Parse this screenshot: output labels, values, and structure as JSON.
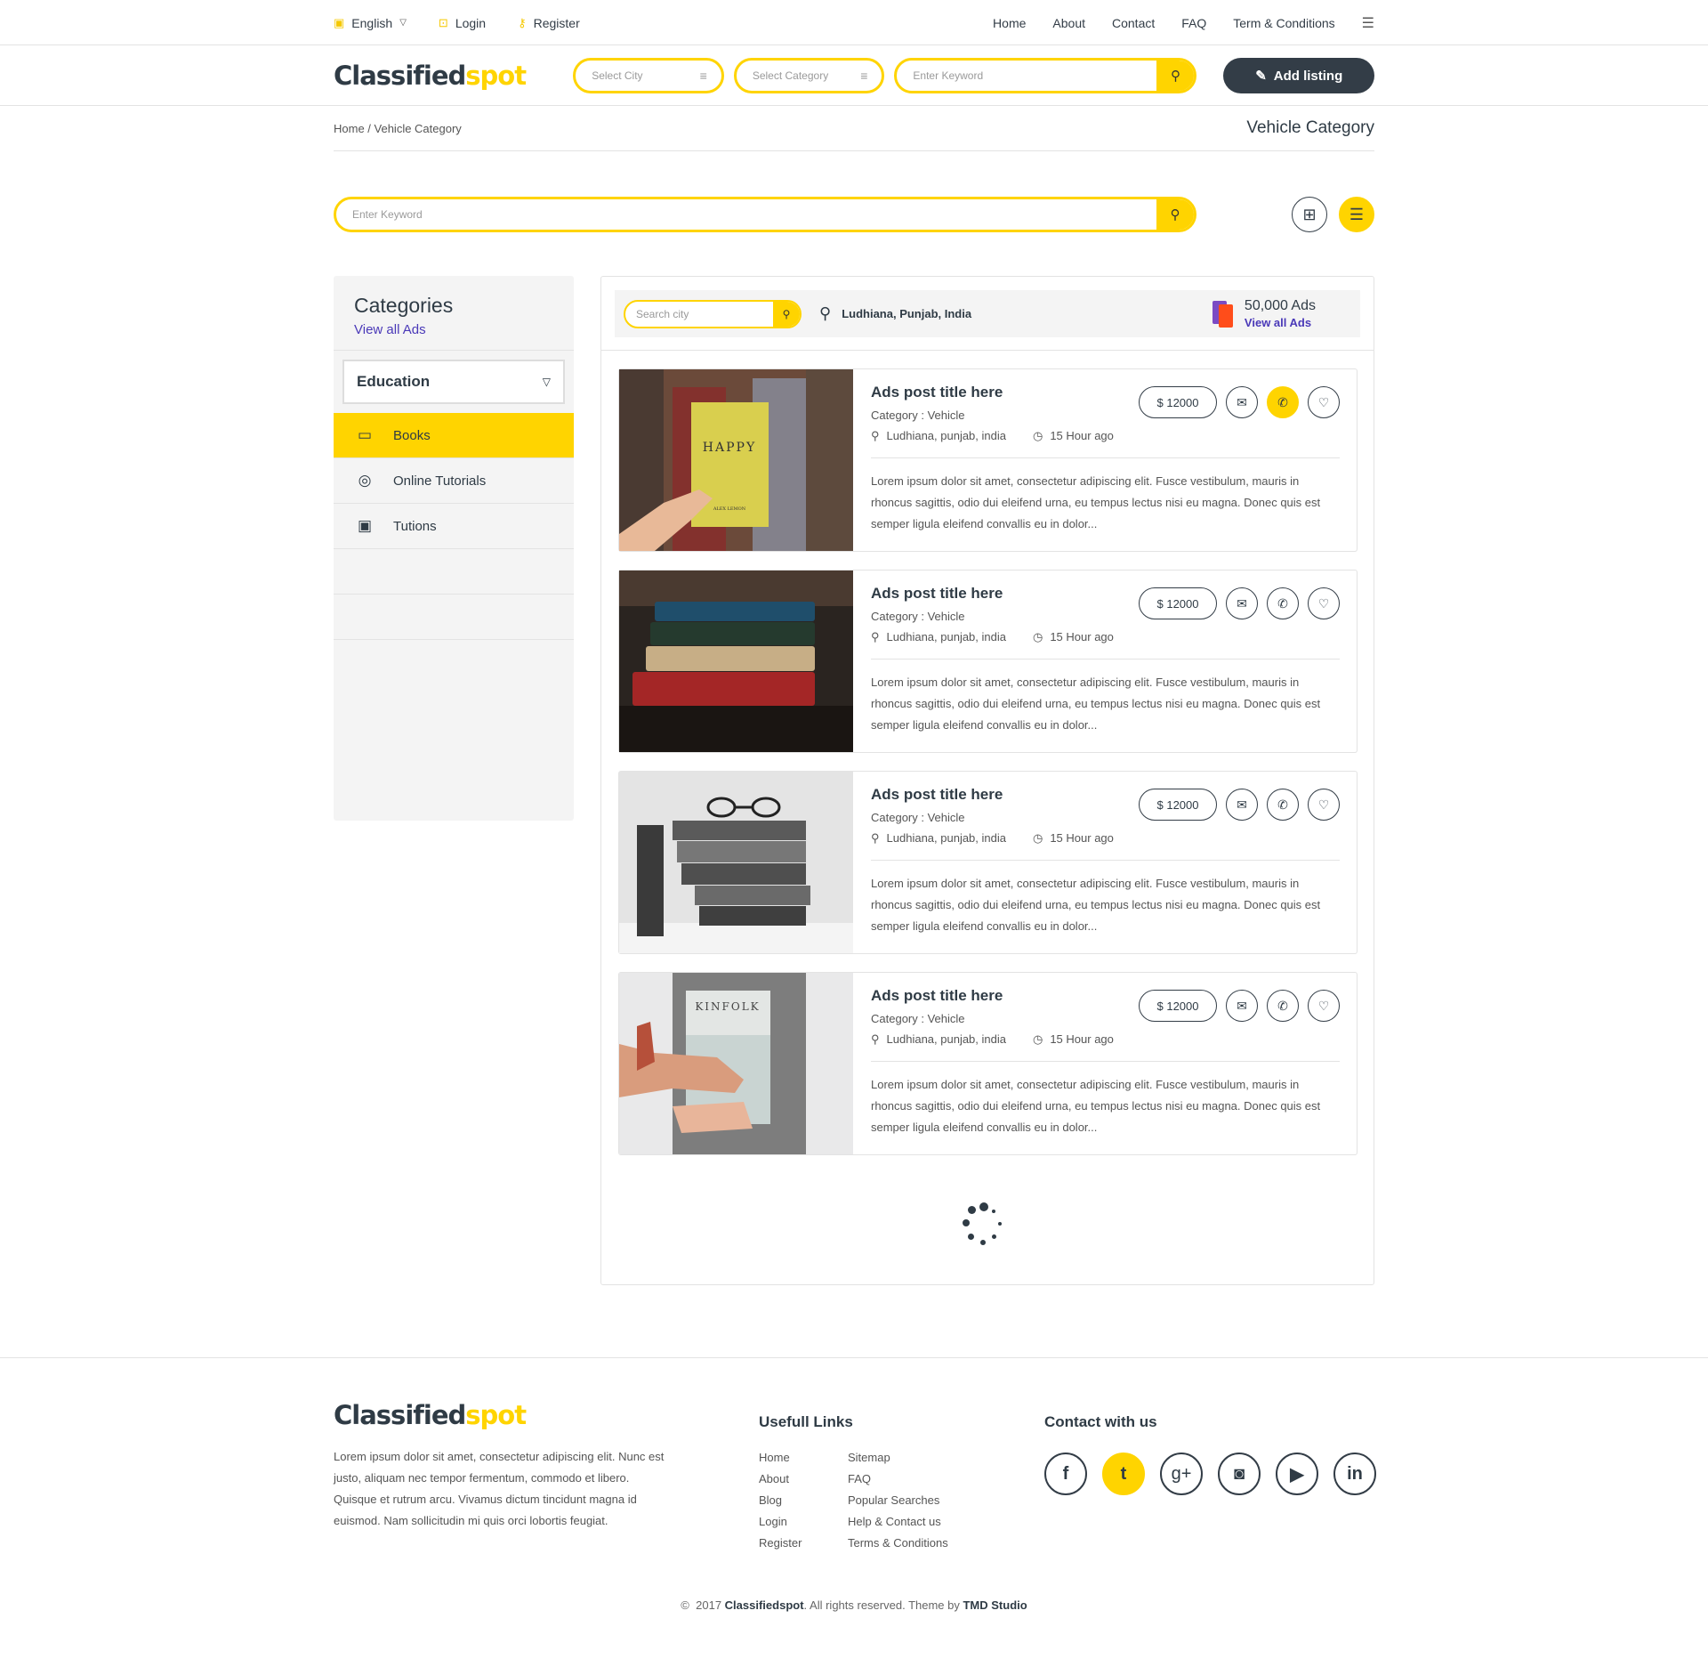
{
  "topbar": {
    "language": "English",
    "login": "Login",
    "register": "Register",
    "nav": [
      "Home",
      "About",
      "Contact",
      "FAQ",
      "Term & Conditions"
    ]
  },
  "header": {
    "logo_main": "Classified",
    "logo_accent": "spot",
    "city_placeholder": "Select City",
    "category_placeholder": "Select Category",
    "keyword_placeholder": "Enter Keyword",
    "add_listing": "Add listing"
  },
  "breadcrumb": {
    "path": "Home / Vehicle Category",
    "page_title": "Vehicle Category"
  },
  "main_search": {
    "placeholder": "Enter Keyword"
  },
  "sidebar": {
    "title": "Categories",
    "view_all": "View all Ads",
    "selected_category": "Education",
    "items": [
      {
        "label": "Books",
        "icon": "book-icon",
        "active": true
      },
      {
        "label": "Online Tutorials",
        "icon": "medal-icon",
        "active": false
      },
      {
        "label": "Tutions",
        "icon": "classroom-icon",
        "active": false
      }
    ]
  },
  "listing_bar": {
    "city_search_placeholder": "Search city",
    "location": "Ludhiana, Punjab, India",
    "ads_count": "50,000 Ads",
    "view_all": "View all Ads"
  },
  "listings": [
    {
      "title": "Ads post title here",
      "category": "Category : Vehicle",
      "location": "Ludhiana, punjab, india",
      "time": "15 Hour ago",
      "price": "$ 12000",
      "description": "Lorem ipsum dolor sit amet, consectetur adipiscing elit. Fusce vestibulum, mauris in rhoncus sagittis, odio dui eleifend urna, eu tempus lectus nisi eu magna. Donec quis est semper ligula eleifend convallis eu in dolor...",
      "image_text": "HAPPY",
      "image_subtext": "ALEX LEMON"
    },
    {
      "title": "Ads post title here",
      "category": "Category : Vehicle",
      "location": "Ludhiana, punjab, india",
      "time": "15 Hour ago",
      "price": "$ 12000",
      "description": "Lorem ipsum dolor sit amet, consectetur adipiscing elit. Fusce vestibulum, mauris in rhoncus sagittis, odio dui eleifend urna, eu tempus lectus nisi eu magna. Donec quis est semper ligula eleifend convallis eu in dolor..."
    },
    {
      "title": "Ads post title here",
      "category": "Category : Vehicle",
      "location": "Ludhiana, punjab, india",
      "time": "15 Hour ago",
      "price": "$ 12000",
      "description": "Lorem ipsum dolor sit amet, consectetur adipiscing elit. Fusce vestibulum, mauris in rhoncus sagittis, odio dui eleifend urna, eu tempus lectus nisi eu magna. Donec quis est semper ligula eleifend convallis eu in dolor..."
    },
    {
      "title": "Ads post title here",
      "category": "Category : Vehicle",
      "location": "Ludhiana, punjab, india",
      "time": "15 Hour ago",
      "price": "$ 12000",
      "description": "Lorem ipsum dolor sit amet, consectetur adipiscing elit. Fusce vestibulum, mauris in rhoncus sagittis, odio dui eleifend urna, eu tempus lectus nisi eu magna. Donec quis est semper ligula eleifend convallis eu in dolor...",
      "image_text": "KINFOLK"
    }
  ],
  "footer": {
    "about": "Lorem ipsum dolor sit amet, consectetur adipiscing elit. Nunc est justo, aliquam nec tempor fermentum, commodo et libero. Quisque et rutrum arcu. Vivamus dictum tincidunt magna id euismod. Nam sollicitudin mi quis orci lobortis feugiat.",
    "links_title": "Usefull Links",
    "links_col1": [
      "Home",
      "About",
      "Blog",
      "Login",
      "Register"
    ],
    "links_col2": [
      "Sitemap",
      "FAQ",
      "Popular Searches",
      "Help & Contact us",
      "Terms & Conditions"
    ],
    "contact_title": "Contact with us",
    "social": [
      "facebook",
      "twitter",
      "google-plus",
      "instagram",
      "youtube",
      "linkedin"
    ],
    "copyright_year": "2017",
    "copyright_brand": "Classifiedspot",
    "copyright_text": ". All rights reserved. Theme by ",
    "copyright_studio": "TMD Studio"
  },
  "colors": {
    "accent": "#ffd400",
    "dark": "#333d47",
    "link": "#4a39b8"
  }
}
